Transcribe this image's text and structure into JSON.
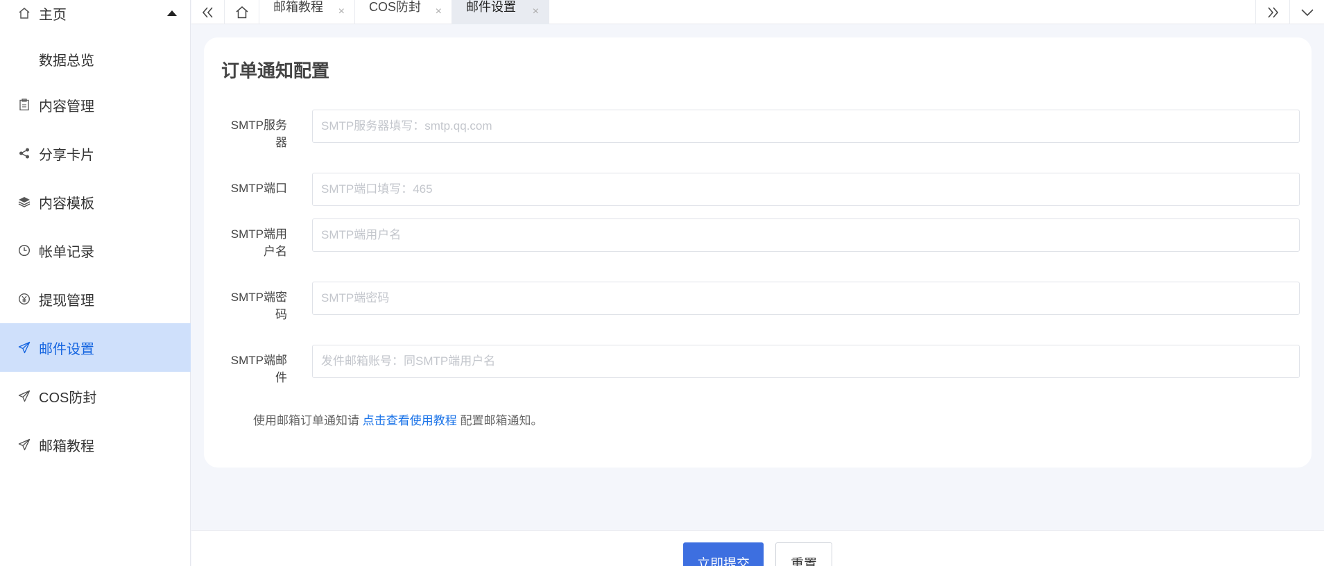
{
  "sidebar": {
    "items": [
      {
        "label": "主页",
        "icon": "home-icon"
      },
      {
        "label": "数据总览"
      },
      {
        "label": "内容管理",
        "icon": "clipboard-icon"
      },
      {
        "label": "分享卡片",
        "icon": "share-icon"
      },
      {
        "label": "内容模板",
        "icon": "layers-icon"
      },
      {
        "label": "帐单记录",
        "icon": "clock-icon"
      },
      {
        "label": "提现管理",
        "icon": "yen-icon"
      },
      {
        "label": "邮件设置",
        "icon": "send-icon"
      },
      {
        "label": "COS防封",
        "icon": "send-icon"
      },
      {
        "label": "邮箱教程",
        "icon": "send-icon"
      }
    ],
    "active_label": "邮件设置"
  },
  "tabs": [
    {
      "label": "邮箱教程"
    },
    {
      "label": "COS防封"
    },
    {
      "label": "邮件设置"
    }
  ],
  "active_tab": "邮件设置",
  "page": {
    "title": "订单通知配置",
    "fields": [
      {
        "label_line1": "SMTP服务",
        "label_line2": "器",
        "placeholder": "SMTP服务器填写：smtp.qq.com",
        "value": ""
      },
      {
        "label_line1": "SMTP端口",
        "label_line2": "",
        "placeholder": "SMTP端口填写：465",
        "value": ""
      },
      {
        "label_line1": "SMTP端用",
        "label_line2": "户名",
        "placeholder": "SMTP端用户名",
        "value": ""
      },
      {
        "label_line1": "SMTP端密",
        "label_line2": "码",
        "placeholder": "SMTP端密码",
        "value": ""
      },
      {
        "label_line1": "SMTP端邮",
        "label_line2": "件",
        "placeholder": "发件邮箱账号：同SMTP端用户名",
        "value": ""
      }
    ],
    "hint_before": "使用邮箱订单通知请",
    "hint_link": "点击查看使用教程",
    "hint_after": "配置邮箱通知。"
  },
  "footer": {
    "submit_label": "立即提交",
    "reset_label": "重置"
  },
  "colors": {
    "accent": "#1565e0",
    "active_bg": "#cfe0fb",
    "primary_button": "#3d6fe0"
  }
}
